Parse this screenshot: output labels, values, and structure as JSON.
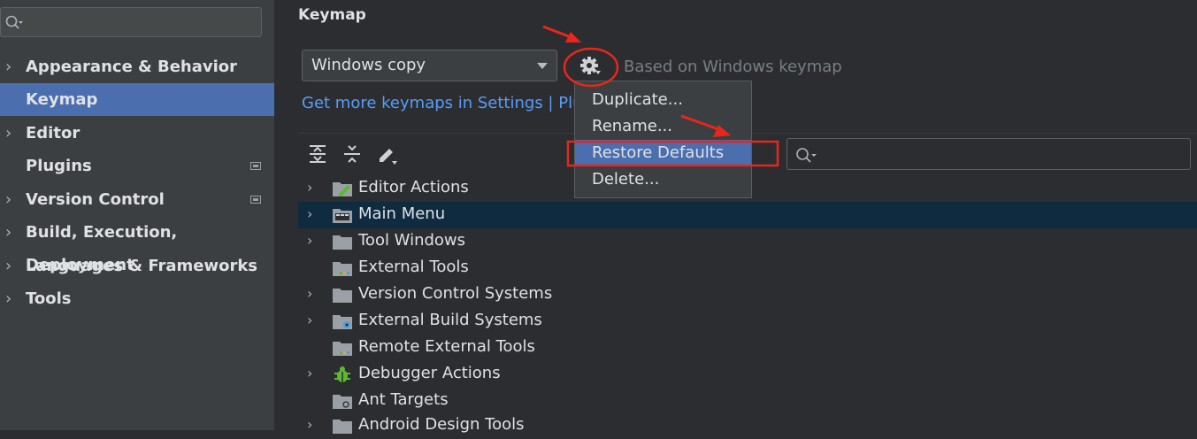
{
  "sidebar": {
    "search": {
      "placeholder": ""
    },
    "items": [
      {
        "label": "Appearance & Behavior",
        "expandable": true
      },
      {
        "label": "Keymap",
        "selected": true
      },
      {
        "label": "Editor",
        "expandable": true
      },
      {
        "label": "Plugins",
        "badge": "settings-page-icon"
      },
      {
        "label": "Version Control",
        "expandable": true,
        "badge": "settings-page-icon"
      },
      {
        "label": "Build, Execution, Deployment",
        "expandable": true
      },
      {
        "label": "Languages & Frameworks",
        "expandable": true
      },
      {
        "label": "Tools",
        "expandable": true
      }
    ]
  },
  "main": {
    "title": "Keymap",
    "keymap_select": {
      "value": "Windows copy"
    },
    "based_on": "Based on Windows keymap",
    "more_link": "Get more keymaps in Settings | Plug",
    "toolbar": {
      "icons": [
        "expand-all-icon",
        "collapse-all-icon",
        "edit-shortcut-icon"
      ]
    },
    "filter": {
      "placeholder": ""
    }
  },
  "gear_menu": {
    "items": [
      {
        "label": "Duplicate..."
      },
      {
        "label": "Rename..."
      },
      {
        "label": "Restore Defaults",
        "selected": true
      },
      {
        "label": "Delete..."
      }
    ]
  },
  "tree": {
    "rows": [
      {
        "label": "Editor Actions",
        "icon": "editor-actions-folder-icon",
        "expandable": true
      },
      {
        "label": "Main Menu",
        "icon": "main-menu-folder-icon",
        "expandable": true,
        "selected": true
      },
      {
        "label": "Tool Windows",
        "icon": "folder-icon",
        "expandable": true
      },
      {
        "label": "External Tools",
        "icon": "external-tools-folder-icon",
        "expandable": false
      },
      {
        "label": "Version Control Systems",
        "icon": "folder-icon",
        "expandable": true
      },
      {
        "label": "External Build Systems",
        "icon": "build-systems-folder-icon",
        "expandable": true
      },
      {
        "label": "Remote External Tools",
        "icon": "external-tools-folder-icon",
        "expandable": false
      },
      {
        "label": "Debugger Actions",
        "icon": "debugger-bug-icon",
        "expandable": true
      },
      {
        "label": "Ant Targets",
        "icon": "ant-folder-icon",
        "expandable": false
      },
      {
        "label": "Android Design Tools",
        "icon": "folder-icon",
        "expandable": true
      }
    ]
  },
  "colors": {
    "accent": "#4b6eaf",
    "link": "#589df6",
    "annotation": "#e8261b",
    "tree_selection": "#0f2b40"
  }
}
